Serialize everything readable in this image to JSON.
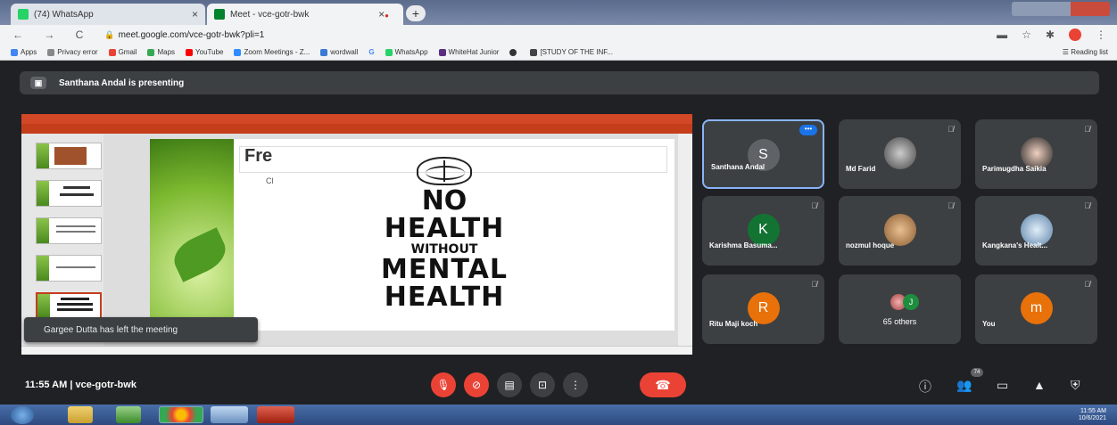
{
  "browser": {
    "tabs": [
      {
        "label": "(74) WhatsApp",
        "close": "×"
      },
      {
        "label": "Meet - vce-gotr-bwk",
        "close": "×"
      }
    ],
    "new_tab": "+",
    "nav": "← → C",
    "url": "meet.google.com/vce-gotr-bwk?pli=1",
    "bookmarks": [
      "Apps",
      "Privacy error",
      "Gmail",
      "Maps",
      "YouTube",
      "Zoom Meetings - Z...",
      "wordwall",
      "G",
      "WhatsApp",
      "WhiteHat Junior",
      "",
      "[STUDY OF THE INF..."
    ],
    "reading_list": "Reading list"
  },
  "meet": {
    "presenting": "Santhana Andal is presenting",
    "toast": "Gargee Dutta has left the meeting",
    "meeting_time": "11:55 AM",
    "separator": "|",
    "meeting_code": "vce-gotr-bwk",
    "participants_badge": "74",
    "tiles": [
      {
        "name": "Santhana Andal",
        "initial": "S",
        "color": "#5f6368"
      },
      {
        "name": "Md Farid",
        "initial": "",
        "color": "#777"
      },
      {
        "name": "Parimugdha Saikia",
        "initial": "",
        "color": "#666"
      },
      {
        "name": "Karishma Basuma...",
        "initial": "K",
        "color": "#137333"
      },
      {
        "name": "nozmul hoque",
        "initial": "",
        "color": "#b08a5a"
      },
      {
        "name": "Kangkana's Healt...",
        "initial": "",
        "color": "#7a9ab8"
      },
      {
        "name": "Ritu Maji koch",
        "initial": "R",
        "color": "#e8710a"
      },
      {
        "name": "65 others",
        "initial": "J",
        "color": "#1e8e3e"
      },
      {
        "name": "You",
        "initial": "m",
        "color": "#e8710a"
      }
    ]
  },
  "slide": {
    "heading": "Fre",
    "sub": "Cl",
    "poster_lines": [
      "NO",
      "HEALTH",
      "WITHOUT",
      "MENTAL",
      "HEALTH"
    ]
  },
  "taskbar": {
    "clock_time": "11:55 AM",
    "clock_date": "10/6/2021"
  }
}
